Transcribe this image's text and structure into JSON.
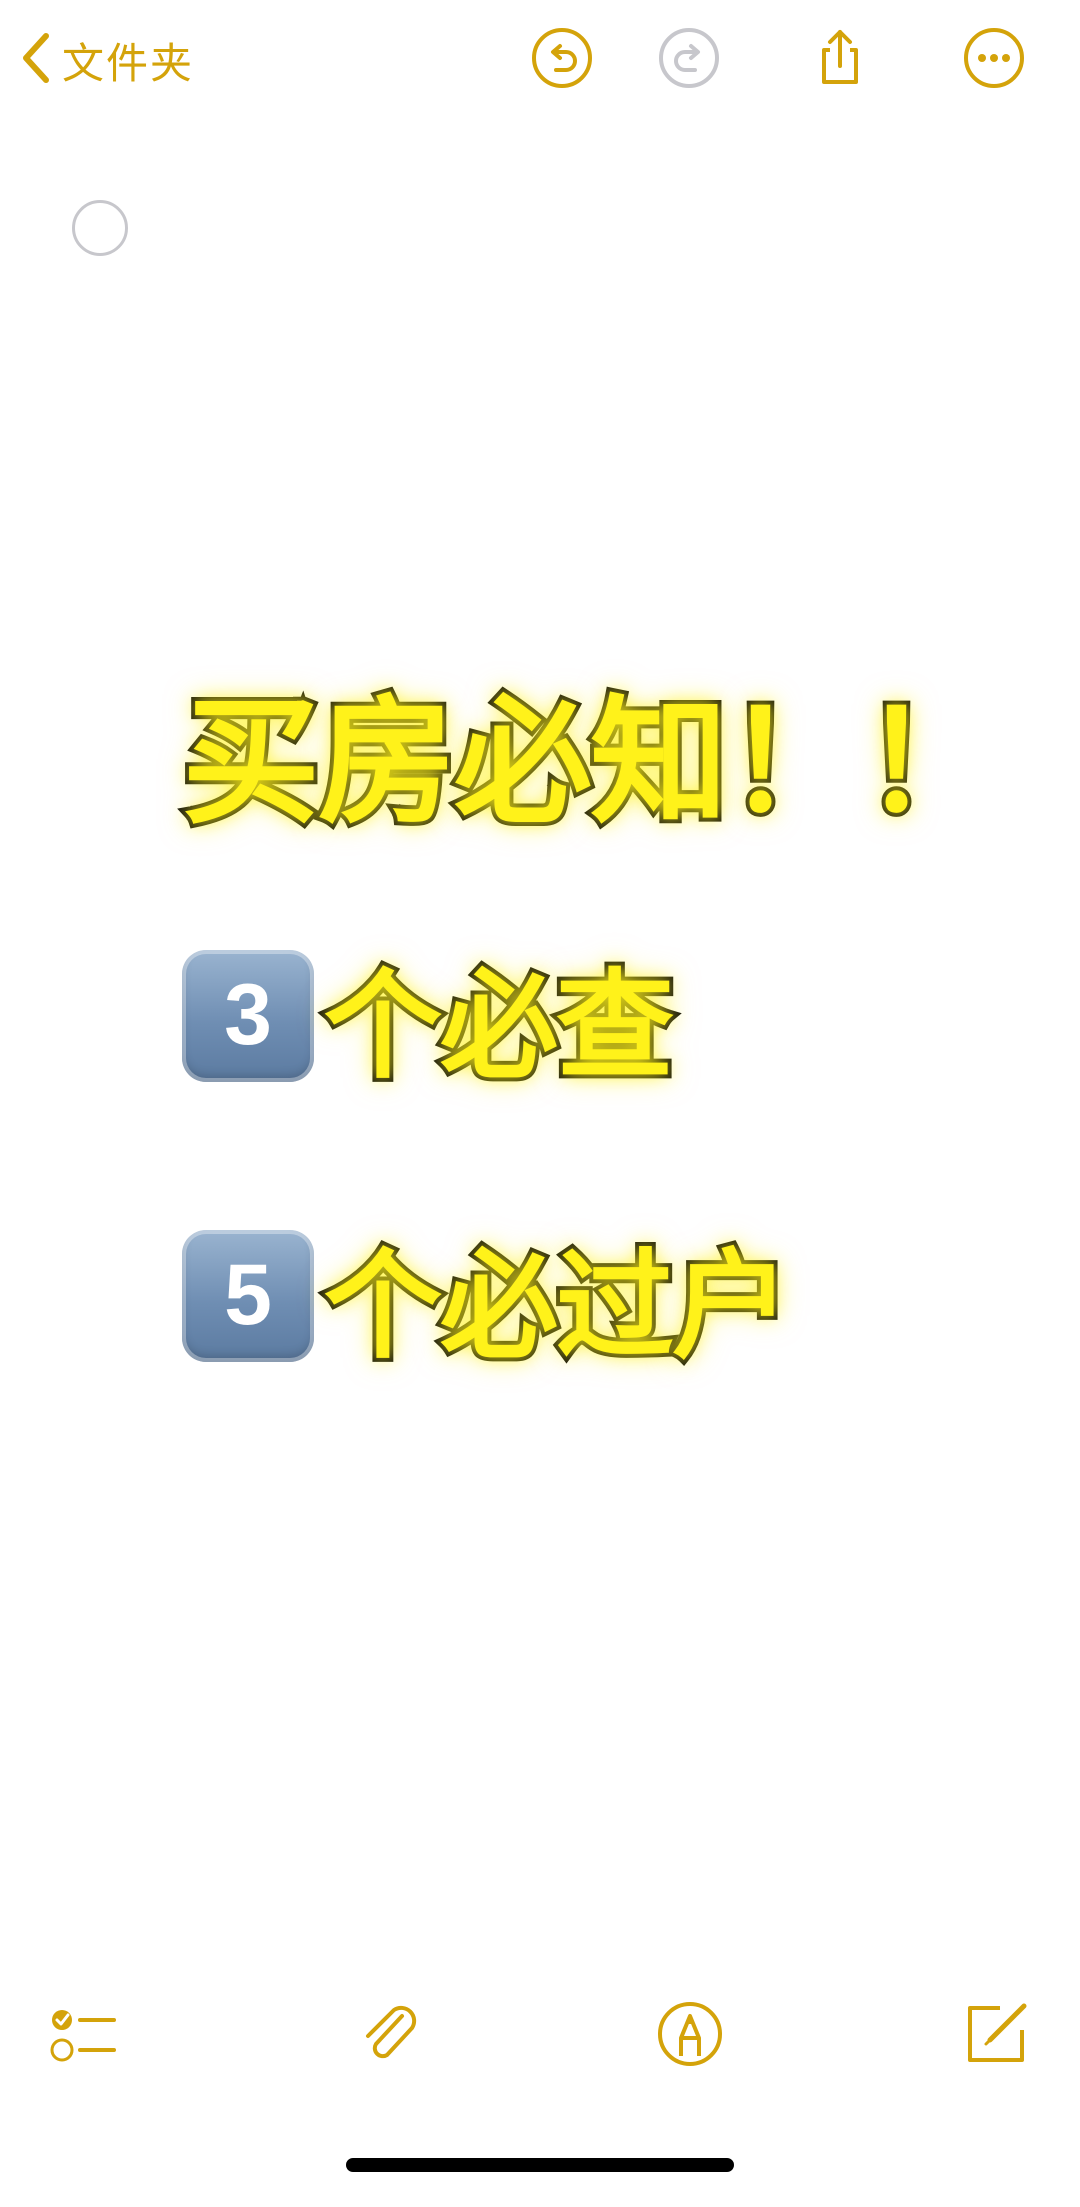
{
  "nav": {
    "back_label": "文件夹",
    "accent_color": "#d4a30a",
    "icons": [
      "chevron-left-icon",
      "undo-icon",
      "redo-icon",
      "share-icon",
      "more-icon"
    ]
  },
  "note": {
    "line1": "买房必知！！",
    "line2_number": "3",
    "line2_text": "个必查",
    "line3_number": "5",
    "line3_text": "个必过户",
    "text_color": "#fff21a",
    "outline_color": "#101010"
  },
  "toolbar": {
    "icons": [
      "checklist-icon",
      "paperclip-icon",
      "markup-pen-icon",
      "compose-icon"
    ]
  }
}
